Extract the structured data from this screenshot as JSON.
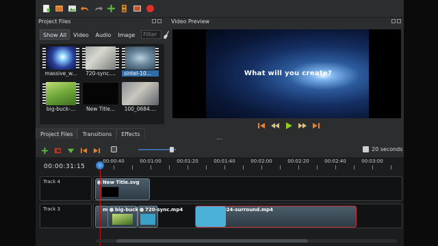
{
  "toolbar": {
    "icons": [
      "new-project-icon",
      "open-project-icon",
      "import-icon",
      "undo-icon",
      "redo-icon",
      "add-track-icon",
      "export-icon",
      "fullscreen-icon",
      "record-icon"
    ]
  },
  "project_files": {
    "title": "Project Files",
    "filters": [
      "Show All",
      "Video",
      "Audio",
      "Image"
    ],
    "filter_placeholder": "Filter",
    "items": [
      {
        "label": "massive_w..."
      },
      {
        "label": "720-sync...."
      },
      {
        "label": "sintel-10..."
      },
      {
        "label": "big-buck-..."
      },
      {
        "label": "New Title..."
      },
      {
        "label": "100_0684...."
      }
    ]
  },
  "bottom_tabs": [
    "Project Files",
    "Transitions",
    "Effects"
  ],
  "video_preview": {
    "title": "Video Preview",
    "overlay_text": "What will you create?"
  },
  "timeline": {
    "current_time": "00:00:31:15",
    "zoom_label": "20 seconds",
    "ruler": [
      "00:00:40",
      "00:01:00",
      "00:01:20",
      "00:01:40",
      "00:02:00",
      "00:02:20",
      "00:02:40",
      "00:03:00"
    ],
    "tracks": [
      {
        "name": "Track 4",
        "clips": [
          {
            "name": "New Title.svg"
          }
        ]
      },
      {
        "name": "Track 3",
        "clips": [
          {
            "name": "m"
          },
          {
            "name": "big-buck-"
          },
          {
            "name": "720-sync.mp4"
          },
          {
            "name": "sintel-1024-surround.mp4"
          }
        ]
      }
    ]
  }
}
